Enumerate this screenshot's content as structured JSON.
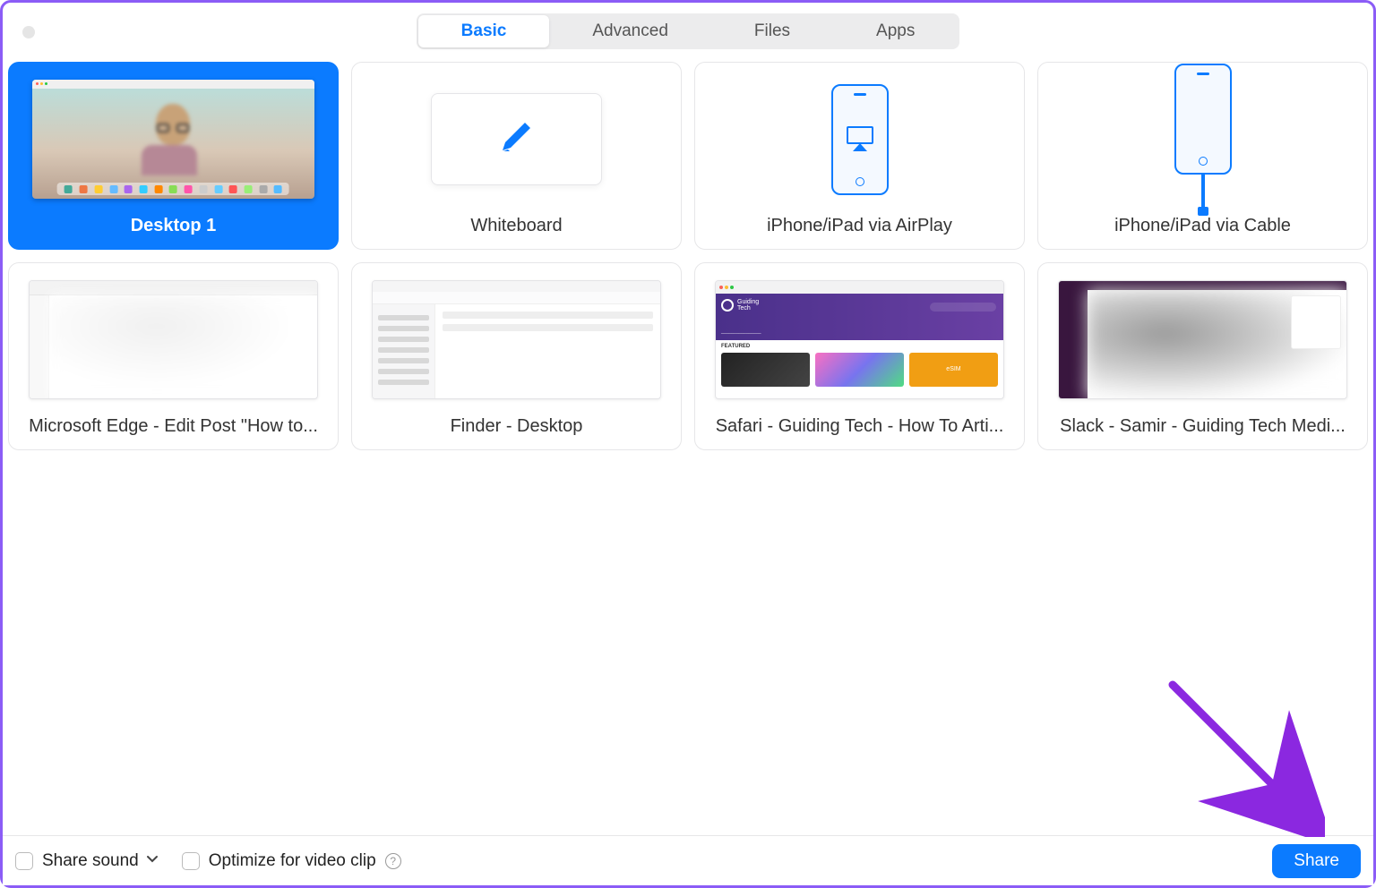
{
  "tabs": {
    "basic": "Basic",
    "advanced": "Advanced",
    "files": "Files",
    "apps": "Apps",
    "active": "basic"
  },
  "tiles": {
    "desktop1": "Desktop 1",
    "whiteboard": "Whiteboard",
    "airplay": "iPhone/iPad via AirPlay",
    "cable": "iPhone/iPad via Cable",
    "edge": "Microsoft Edge - Edit Post \"How to...",
    "finder": "Finder - Desktop",
    "safari": "Safari - Guiding Tech - How To Arti...",
    "slack": "Slack - Samir - Guiding Tech Medi..."
  },
  "safari_hero": {
    "brand1": "Guiding",
    "brand2": "Tech",
    "featured": "FEATURED"
  },
  "bottom": {
    "share_sound": "Share sound",
    "optimize": "Optimize for video clip",
    "share": "Share"
  },
  "colors": {
    "accent": "#0b7bff",
    "annotation": "#8b28e0"
  }
}
